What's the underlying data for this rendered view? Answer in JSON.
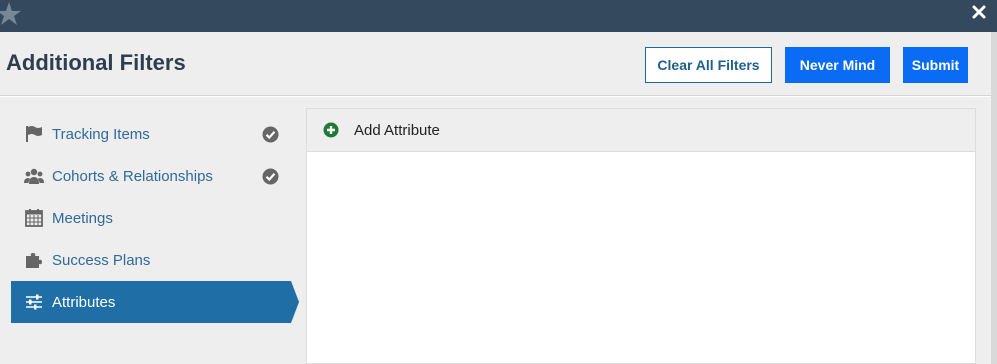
{
  "colors": {
    "topbar": "#34495e",
    "primary_button": "#0a6bf5",
    "active_nav": "#1f6ea6",
    "link_text": "#2f6a99",
    "add_icon": "#1f7a34"
  },
  "topbar": {
    "logo_icon": "star-logo-icon",
    "close_icon": "close-icon"
  },
  "header": {
    "title": "Additional Filters",
    "clear_label": "Clear All Filters",
    "never_mind_label": "Never Mind",
    "submit_label": "Submit"
  },
  "sidebar": {
    "items": [
      {
        "label": "Tracking Items",
        "icon": "flag-icon",
        "checked": true,
        "active": false
      },
      {
        "label": "Cohorts & Relationships",
        "icon": "users-icon",
        "checked": true,
        "active": false
      },
      {
        "label": "Meetings",
        "icon": "calendar-icon",
        "checked": false,
        "active": false
      },
      {
        "label": "Success Plans",
        "icon": "puzzle-icon",
        "checked": false,
        "active": false
      },
      {
        "label": "Attributes",
        "icon": "sliders-icon",
        "checked": false,
        "active": true
      }
    ]
  },
  "main": {
    "add_attribute_label": "Add Attribute",
    "add_icon": "plus-circle-icon"
  }
}
